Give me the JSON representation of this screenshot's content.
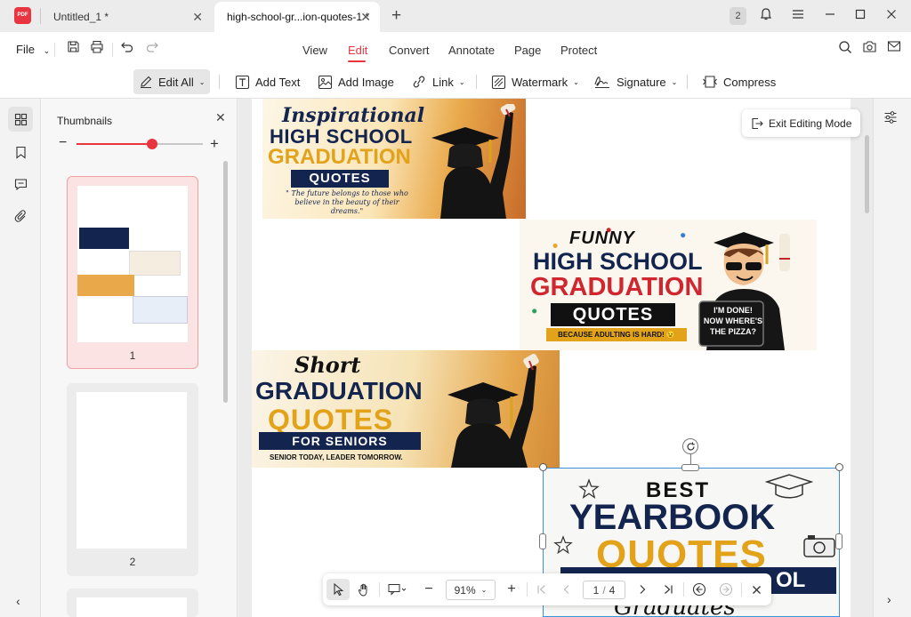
{
  "titlebar": {
    "logo_text": "PDF",
    "tabs": [
      {
        "label": "Untitled_1 *",
        "active": false
      },
      {
        "label": "high-school-gr...ion-quotes-1 *",
        "active": true
      }
    ],
    "badge_count": "2"
  },
  "menubar": {
    "file_label": "File",
    "items": [
      "View",
      "Edit",
      "Convert",
      "Annotate",
      "Page",
      "Protect"
    ],
    "active_item": "Edit"
  },
  "toolbar": {
    "edit_all": "Edit All",
    "add_text": "Add Text",
    "add_image": "Add Image",
    "link": "Link",
    "watermark": "Watermark",
    "signature": "Signature",
    "compress": "Compress"
  },
  "thumbnails": {
    "title": "Thumbnails",
    "zoom_fraction": 0.6,
    "pages": [
      {
        "number": "1"
      },
      {
        "number": "2"
      }
    ]
  },
  "exit_editing": "Exit Editing Mode",
  "banners": {
    "inspirational": {
      "script": "Inspirational",
      "line1": "HIGH SCHOOL",
      "line2": "GRADUATION",
      "line3": "QUOTES",
      "tagline": "\" The future belongs to those who believe in the beauty of their dreams.\""
    },
    "funny": {
      "script": "FUNNY",
      "line1": "HIGH SCHOOL",
      "line2": "GRADUATION",
      "line3": "QUOTES",
      "ribbon": "BECAUSE ADULTING IS HARD! 😉",
      "sign": "I'M DONE! NOW WHERE'S THE PIZZA?"
    },
    "short": {
      "script": "Short",
      "line1": "GRADUATION",
      "line2": "QUOTES",
      "ribbon": "FOR SENIORS",
      "tagline": "SENIOR TODAY, LEADER TOMORROW."
    },
    "yearbook": {
      "line1": "BEST",
      "line2": "YEARBOOK",
      "line3": "QUOTES",
      "ribbon": "OL",
      "script": "Graduates"
    }
  },
  "bottombar": {
    "zoom": "91%",
    "current_page": "1",
    "page_sep": "/",
    "total_pages": "4"
  },
  "colors": {
    "accent": "#e8353f",
    "navy": "#13254f",
    "gold": "#e2a31b",
    "red": "#d0262f",
    "selection": "#3d8fd9"
  }
}
